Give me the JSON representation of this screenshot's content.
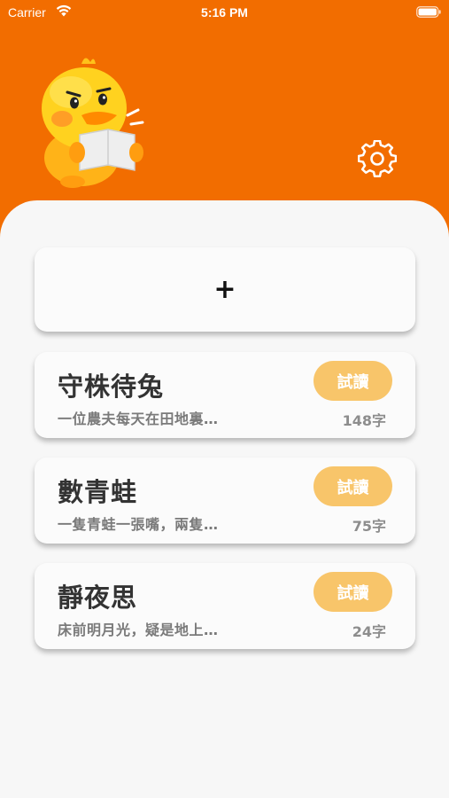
{
  "status_bar": {
    "carrier": "Carrier",
    "time": "5:16 PM"
  },
  "header": {
    "background": "#f26d00",
    "settings_icon": "gear-icon",
    "mascot": "duck-reading-mascot"
  },
  "add_card": {
    "icon": "plus-icon",
    "label": "+"
  },
  "stories": [
    {
      "title": "守株待兔",
      "excerpt": "一位農夫每天在田地裏…",
      "button": "試讀",
      "count": "148字"
    },
    {
      "title": "數青蛙",
      "excerpt": "一隻青蛙一張嘴，兩隻…",
      "button": "試讀",
      "count": "75字"
    },
    {
      "title": "靜夜思",
      "excerpt": "床前明月光，疑是地上…",
      "button": "試讀",
      "count": "24字"
    }
  ],
  "colors": {
    "accent": "#f26d00",
    "button": "#f8c56a",
    "card": "#fbfbfb",
    "background": "#f7f7f7"
  }
}
